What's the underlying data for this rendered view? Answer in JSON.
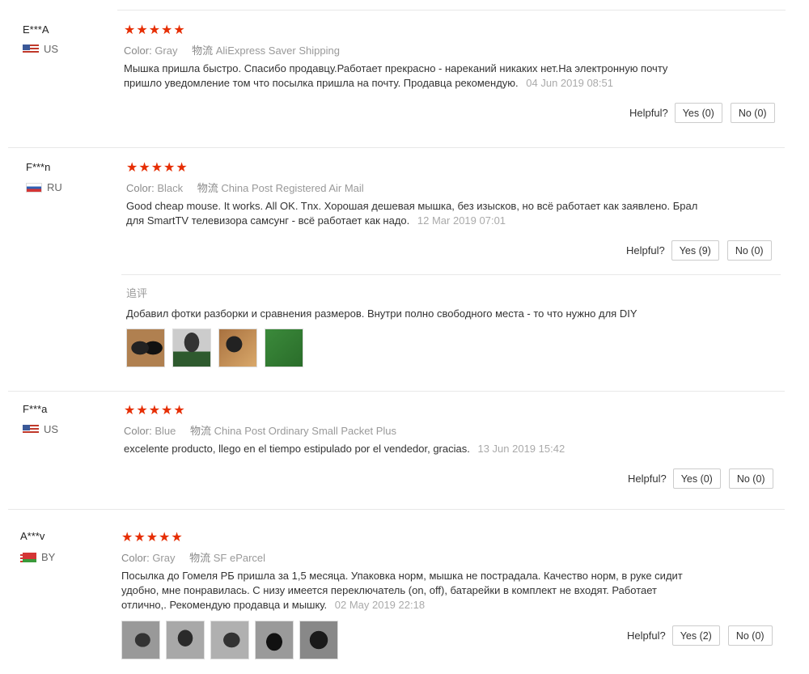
{
  "helpful_label": "Helpful?",
  "color_label": "Color:",
  "shipping_label": "物流",
  "reviews": [
    {
      "user": "E***A",
      "country": "US",
      "stars": "★★★★★",
      "color": "Gray",
      "shipping": "AliExpress Saver Shipping",
      "text": "Мышка пришла быстро. Спасибо продавцу.Работает прекрасно - нареканий никаких нет.На электронную почту пришло уведомление том что посылка пришла на почту. Продавца рекомендую.",
      "date": "04 Jun 2019 08:51",
      "yes": "Yes (0)",
      "no": "No (0)"
    },
    {
      "user": "F***n",
      "country": "RU",
      "stars": "★★★★★",
      "color": "Black",
      "shipping": "China Post Registered Air Mail",
      "text": "Good cheap mouse. It works. All OK. Tnx. Хорошая дешевая мышка, без изысков, но всё работает как заявлено. Брал для SmartTV телевизора самсунг - всё работает как надо.",
      "date": "12 Mar 2019 07:01",
      "yes": "Yes (9)",
      "no": "No (0)",
      "followup_label": "追评",
      "followup_text": "Добавил фотки разборки и сравнения размеров. Внутри полно свободного места - то что нужно для DIY"
    },
    {
      "user": "F***a",
      "country": "US",
      "stars": "★★★★★",
      "color": "Blue",
      "shipping": "China Post Ordinary Small Packet Plus",
      "text": "excelente producto, llego en el tiempo estipulado por el vendedor, gracias.",
      "date": "13 Jun 2019 15:42",
      "yes": "Yes (0)",
      "no": "No (0)"
    },
    {
      "user": "A***v",
      "country": "BY",
      "stars": "★★★★★",
      "color": "Gray",
      "shipping": "SF eParcel",
      "text": "Посылка до Гомеля РБ пришла за 1,5 месяца. Упаковка норм, мышка не пострадала. Качество норм, в руке сидит удобно, мне понравилась. С низу имеется переключатель (on, off), батарейки в комплект не входят. Работает отлично,. Рекомендую продавца и мышку.",
      "date": "02 May 2019 22:18",
      "yes": "Yes (2)",
      "no": "No (0)"
    }
  ]
}
